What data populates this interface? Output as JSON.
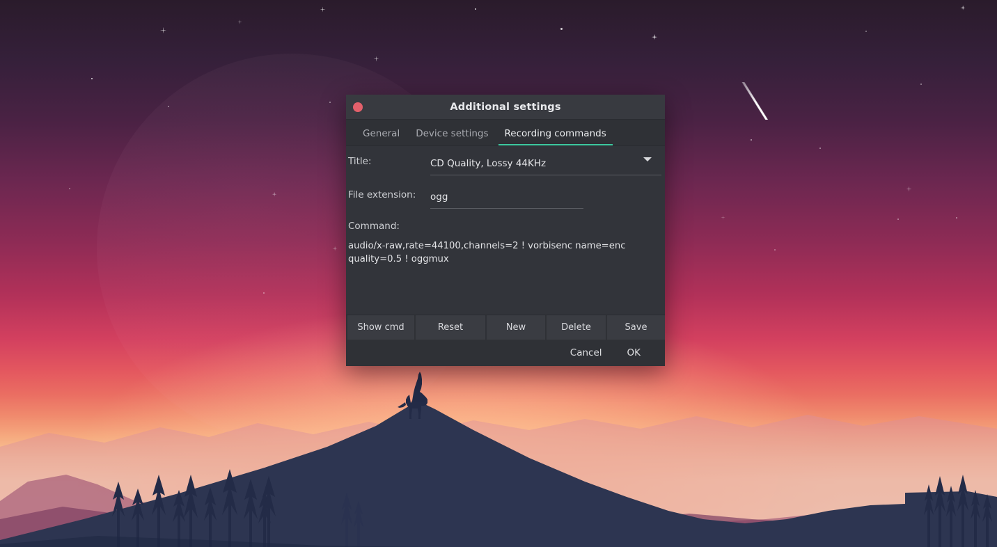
{
  "window": {
    "title": "Additional settings",
    "close_icon": "close-dot-icon",
    "accent_color": "#3dc9a0",
    "close_color": "#e2606b",
    "background_color": "#32343a"
  },
  "tabs": [
    {
      "label": "General",
      "active": false
    },
    {
      "label": "Device settings",
      "active": false
    },
    {
      "label": "Recording commands",
      "active": true
    }
  ],
  "form": {
    "title_label": "Title:",
    "title_value": "CD Quality, Lossy 44KHz",
    "title_dropdown_icon": "chevron-down-icon",
    "extension_label": "File extension:",
    "extension_value": "ogg",
    "command_label": "Command:",
    "command_value": "audio/x-raw,rate=44100,channels=2 ! vorbisenc name=enc quality=0.5 ! oggmux"
  },
  "action_buttons": [
    {
      "label": "Show cmd"
    },
    {
      "label": "Reset"
    },
    {
      "label": "New"
    },
    {
      "label": "Delete"
    },
    {
      "label": "Save"
    }
  ],
  "footer": {
    "cancel_label": "Cancel",
    "ok_label": "OK"
  }
}
